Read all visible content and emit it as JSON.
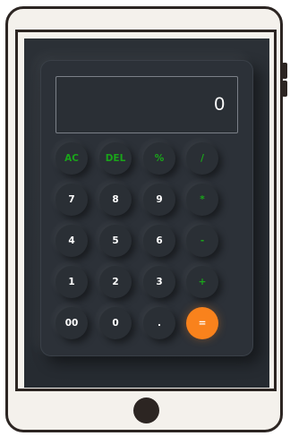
{
  "display": {
    "value": "0"
  },
  "keys": {
    "ac": "AC",
    "del": "DEL",
    "percent": "%",
    "divide": "/",
    "seven": "7",
    "eight": "8",
    "nine": "9",
    "multiply": "*",
    "four": "4",
    "five": "5",
    "six": "6",
    "minus": "-",
    "one": "1",
    "two": "2",
    "three": "3",
    "plus": "+",
    "double_zero": "00",
    "zero": "0",
    "dot": ".",
    "equals": "="
  },
  "colors": {
    "operator": "#1aa51a",
    "equals_bg": "#f9821c",
    "body_bg": "#2c3138",
    "device_frame": "#2c2522",
    "device_bezel": "#f4f1ec"
  }
}
